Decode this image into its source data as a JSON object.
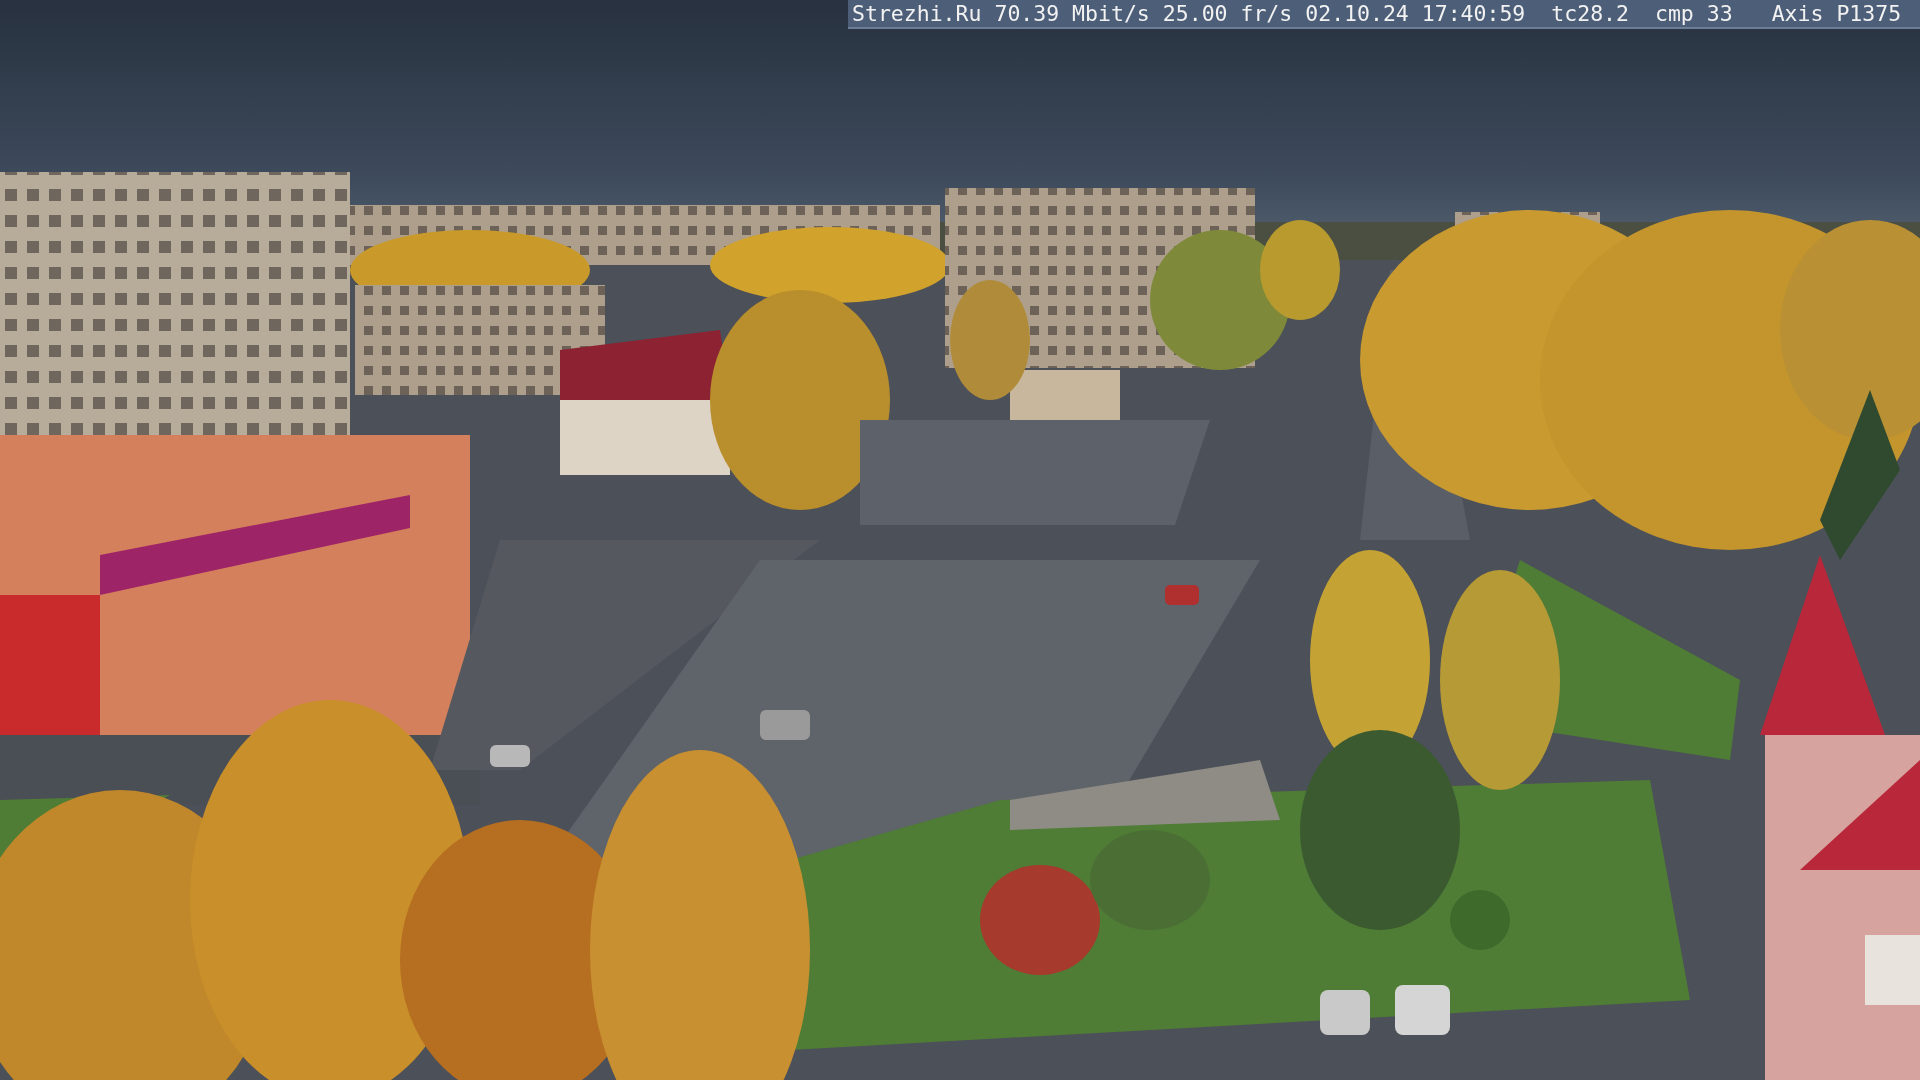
{
  "camera_overlay": {
    "site": "Strezhi.Ru",
    "bitrate": "70.39 Mbit/s",
    "frame_rate": "25.00 fr/s",
    "timestamp": "02.10.24 17:40:59",
    "tc": "tc28.2",
    "compression": "cmp 33",
    "camera_model": "Axis P1375"
  }
}
